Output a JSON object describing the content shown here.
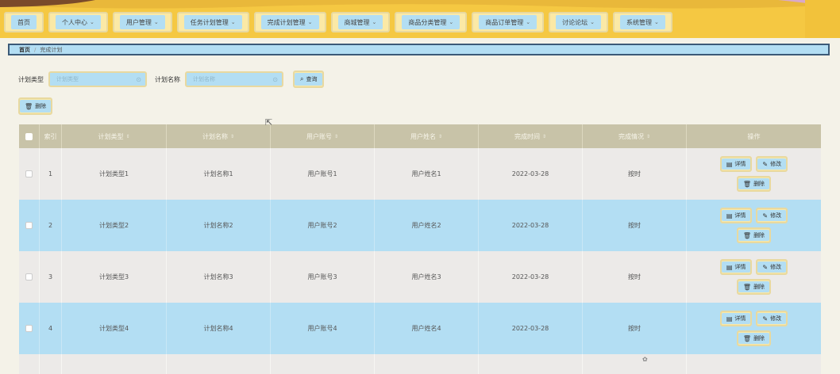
{
  "nav": {
    "items": [
      {
        "label": "首页",
        "has_dropdown": false
      },
      {
        "label": "个人中心",
        "has_dropdown": true
      },
      {
        "label": "用户管理",
        "has_dropdown": true
      },
      {
        "label": "任务计划管理",
        "has_dropdown": true
      },
      {
        "label": "完成计划管理",
        "has_dropdown": true
      },
      {
        "label": "商城管理",
        "has_dropdown": true
      },
      {
        "label": "商品分类管理",
        "has_dropdown": true
      },
      {
        "label": "商品订单管理",
        "has_dropdown": true
      },
      {
        "label": "讨论论坛",
        "has_dropdown": true
      },
      {
        "label": "系统管理",
        "has_dropdown": true
      }
    ]
  },
  "breadcrumb": {
    "home": "首页",
    "sep": "/",
    "current": "完成计划"
  },
  "search": {
    "type_label": "计划类型",
    "type_placeholder": "计划类型",
    "name_label": "计划名称",
    "name_placeholder": "计划名称",
    "query_button": "查询"
  },
  "actions": {
    "delete_button": "删除"
  },
  "table": {
    "headers": [
      "索引",
      "计划类型",
      "计划名称",
      "用户账号",
      "用户姓名",
      "完成时间",
      "完成情况",
      "操作"
    ],
    "rows": [
      {
        "index": "1",
        "type": "计划类型1",
        "name": "计划名称1",
        "account": "用户账号1",
        "username": "用户姓名1",
        "time": "2022-03-28",
        "status": "按时"
      },
      {
        "index": "2",
        "type": "计划类型2",
        "name": "计划名称2",
        "account": "用户账号2",
        "username": "用户姓名2",
        "time": "2022-03-28",
        "status": "按时"
      },
      {
        "index": "3",
        "type": "计划类型3",
        "name": "计划名称3",
        "account": "用户账号3",
        "username": "用户姓名3",
        "time": "2022-03-28",
        "status": "按时"
      },
      {
        "index": "4",
        "type": "计划类型4",
        "name": "计划名称4",
        "account": "用户账号4",
        "username": "用户姓名4",
        "time": "2022-03-28",
        "status": "按时"
      }
    ],
    "row_actions": {
      "detail": "详情",
      "edit": "修改",
      "delete": "删除"
    }
  },
  "colors": {
    "nav_bg": "#f5c842",
    "accent_blue": "#b3def3",
    "button_frame": "#fbe9a6",
    "header_bg": "#c8c3a8",
    "page_bg": "#f4f2e8"
  }
}
